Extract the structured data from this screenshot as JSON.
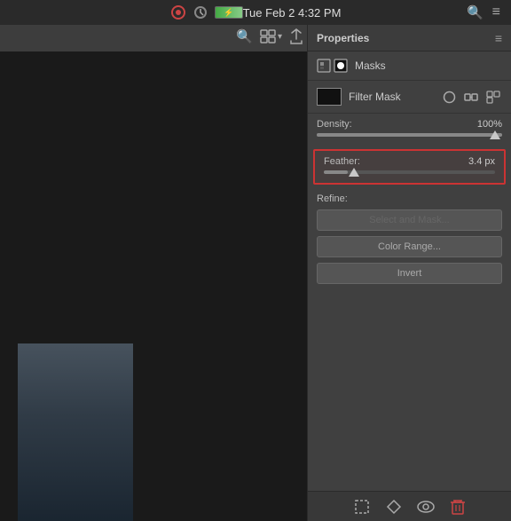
{
  "menubar": {
    "time": "Tue Feb 2  4:32 PM",
    "search_icon": "🔍",
    "menu_icon": "≡"
  },
  "canvas_toolbar": {
    "zoom_icon": "🔍",
    "arrange_icon": "⊞",
    "share_icon": "↑"
  },
  "properties_panel": {
    "title": "Properties",
    "menu_icon": "≡",
    "masks_label": "Masks",
    "filter_mask_label": "Filter Mask",
    "density": {
      "label": "Density:",
      "value": "100%",
      "fill_percent": 100
    },
    "feather": {
      "label": "Feather:",
      "value": "3.4 px",
      "fill_percent": 14
    },
    "refine": {
      "label": "Refine:",
      "select_and_mask_label": "Select and Mask...",
      "color_range_label": "Color Range...",
      "invert_label": "Invert"
    }
  },
  "bottom_toolbar": {
    "select_icon": "⬚",
    "edit_icon": "◇",
    "eye_icon": "👁",
    "trash_icon": "🗑"
  }
}
